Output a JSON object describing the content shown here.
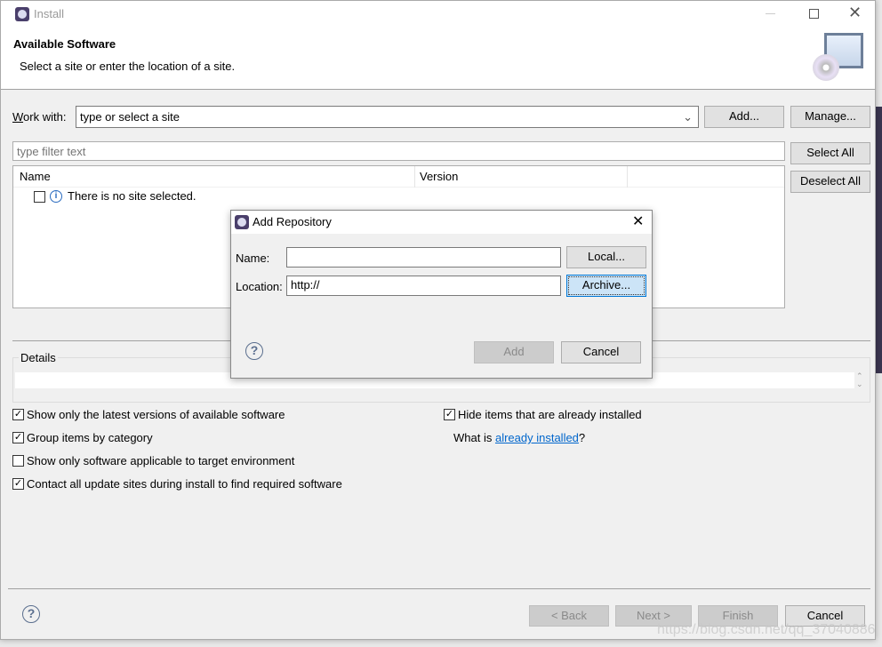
{
  "window": {
    "title": "Install",
    "minimize_icon": "minimize-icon",
    "maximize_icon": "maximize-icon",
    "close_icon": "close-icon"
  },
  "header": {
    "title": "Available Software",
    "subtitle": "Select a site or enter the location of a site."
  },
  "work_with": {
    "label": "Work with:",
    "value": "type or select a site",
    "add_label": "Add...",
    "manage_label": "Manage..."
  },
  "filter": {
    "placeholder": "type filter text",
    "select_all": "Select All",
    "deselect_all": "Deselect All"
  },
  "table": {
    "columns": [
      "Name",
      "Version"
    ],
    "rows": [
      {
        "checked": false,
        "text": "There is no site selected."
      }
    ]
  },
  "details": {
    "label": "Details"
  },
  "options": {
    "latest": {
      "label": "Show only the latest versions of available software",
      "checked": true
    },
    "group": {
      "label": "Group items by category",
      "checked": true
    },
    "applicable": {
      "label": "Show only software applicable to target environment",
      "checked": false
    },
    "contact": {
      "label": "Contact all update sites during install to find required software",
      "checked": true
    },
    "hide": {
      "label": "Hide items that are already installed",
      "checked": true
    },
    "what_is": "What is ",
    "already_installed_link": "already installed",
    "question": "?"
  },
  "footer": {
    "back": "< Back",
    "next": "Next >",
    "finish": "Finish",
    "cancel": "Cancel"
  },
  "dialog": {
    "title": "Add Repository",
    "name_label": "Name:",
    "name_value": "",
    "location_label": "Location:",
    "location_value": "http://",
    "local": "Local...",
    "archive": "Archive...",
    "add": "Add",
    "cancel": "Cancel"
  },
  "watermark": "https://blog.csdn.net/qq_37040886",
  "colors": {
    "link": "#0066cc",
    "focus": "#0078d7",
    "focus_bg": "#cce4f7"
  }
}
